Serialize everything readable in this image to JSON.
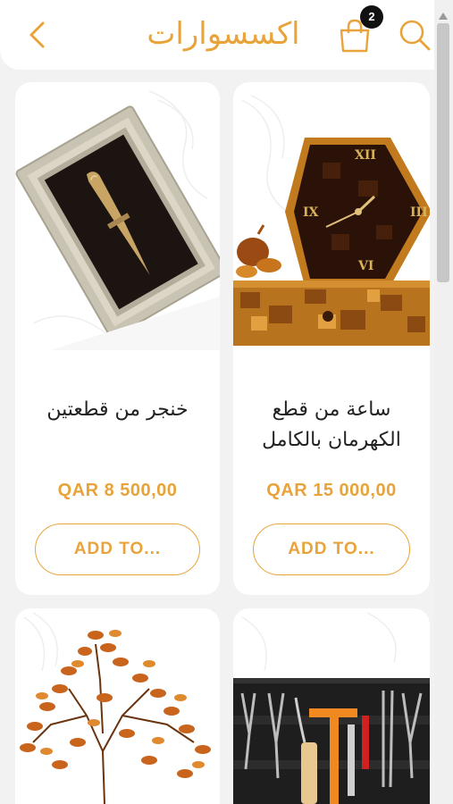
{
  "header": {
    "title": "اكسسوارات",
    "cart_count": "2",
    "back_icon": "chevron-left-icon",
    "cart_icon": "shopping-bag-icon",
    "search_icon": "search-icon"
  },
  "colors": {
    "accent": "#e8a43a",
    "background": "#f2f2f2",
    "card": "#ffffff",
    "text": "#222222"
  },
  "products": [
    {
      "name": "خنجر من قطعتين",
      "price": "QAR 8 500,00",
      "button": "ADD TO...",
      "image": "framed-dagger"
    },
    {
      "name": "ساعة من قطع الكهرمان بالكامل",
      "price": "QAR 15 000,00",
      "button": "ADD TO...",
      "image": "amber-clock"
    },
    {
      "image": "amber-tree"
    },
    {
      "image": "tool-kit"
    }
  ]
}
